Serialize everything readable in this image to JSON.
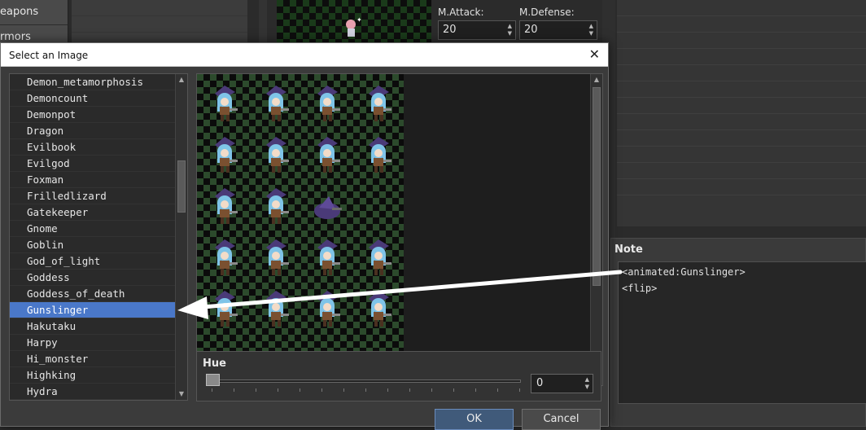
{
  "background": {
    "nav": [
      "eapons",
      "rmors"
    ],
    "stats": [
      {
        "label": "M.Attack:",
        "value": "20"
      },
      {
        "label": "M.Defense:",
        "value": "20"
      }
    ],
    "note": {
      "title": "Note",
      "text": "<animated:Gunslinger>\n<flip>"
    }
  },
  "dialog": {
    "title": "Select an Image",
    "files": [
      "Demon_metamorphosis",
      "Demoncount",
      "Demonpot",
      "Dragon",
      "Evilbook",
      "Evilgod",
      "Foxman",
      "Frilledlizard",
      "Gatekeeper",
      "Gnome",
      "Goblin",
      "God_of_light",
      "Goddess",
      "Goddess_of_death",
      "Gunslinger",
      "Hakutaku",
      "Harpy",
      "Hi_monster",
      "Highking",
      "Hydra"
    ],
    "selected_file": "Gunslinger",
    "hue": {
      "label": "Hue",
      "value": "0"
    },
    "ok_label": "OK",
    "cancel_label": "Cancel"
  },
  "colors": {
    "selection": "#4a78c9",
    "sprite_hair": "#7fc4e8",
    "sprite_hat": "#4a3a78",
    "annotation_arrow": "#ffffff"
  },
  "icons": {
    "close": "close-icon",
    "spin_up": "triangle-up-icon",
    "spin_down": "triangle-down-icon"
  }
}
